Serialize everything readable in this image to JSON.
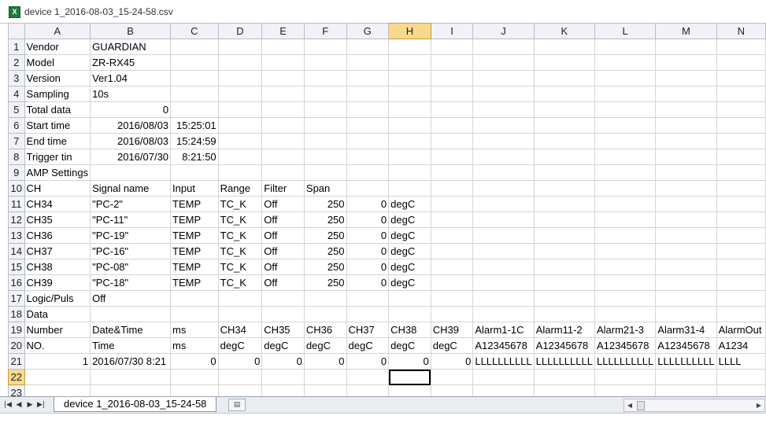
{
  "window": {
    "title": "device 1_2016-08-03_15-24-58.csv",
    "icon": "excel-icon"
  },
  "columns": [
    "A",
    "B",
    "C",
    "D",
    "E",
    "F",
    "G",
    "H",
    "I",
    "J",
    "K",
    "L",
    "M",
    "N"
  ],
  "selected_column": "H",
  "selected_row": 22,
  "rows": [
    {
      "n": "1",
      "cells": [
        "Vendor",
        "GUARDIAN",
        "",
        "",
        "",
        "",
        "",
        "",
        "",
        "",
        "",
        "",
        "",
        ""
      ]
    },
    {
      "n": "2",
      "cells": [
        "Model",
        "ZR-RX45",
        "",
        "",
        "",
        "",
        "",
        "",
        "",
        "",
        "",
        "",
        "",
        ""
      ]
    },
    {
      "n": "3",
      "cells": [
        "Version",
        "Ver1.04",
        "",
        "",
        "",
        "",
        "",
        "",
        "",
        "",
        "",
        "",
        "",
        ""
      ]
    },
    {
      "n": "4",
      "cells": [
        "Sampling",
        "10s",
        "",
        "",
        "",
        "",
        "",
        "",
        "",
        "",
        "",
        "",
        "",
        ""
      ]
    },
    {
      "n": "5",
      "cells": [
        "Total data",
        "0",
        "",
        "",
        "",
        "",
        "",
        "",
        "",
        "",
        "",
        "",
        "",
        ""
      ]
    },
    {
      "n": "6",
      "cells": [
        "Start time",
        "2016/08/03",
        "15:25:01",
        "",
        "",
        "",
        "",
        "",
        "",
        "",
        "",
        "",
        "",
        ""
      ]
    },
    {
      "n": "7",
      "cells": [
        "End time",
        "2016/08/03",
        "15:24:59",
        "",
        "",
        "",
        "",
        "",
        "",
        "",
        "",
        "",
        "",
        ""
      ]
    },
    {
      "n": "8",
      "cells": [
        "Trigger tin",
        "2016/07/30",
        "8:21:50",
        "",
        "",
        "",
        "",
        "",
        "",
        "",
        "",
        "",
        "",
        ""
      ]
    },
    {
      "n": "9",
      "cells": [
        "AMP Settings",
        "",
        "",
        "",
        "",
        "",
        "",
        "",
        "",
        "",
        "",
        "",
        "",
        ""
      ]
    },
    {
      "n": "10",
      "cells": [
        "CH",
        "Signal name",
        "Input",
        "Range",
        "Filter",
        "Span",
        "",
        "",
        "",
        "",
        "",
        "",
        "",
        ""
      ]
    },
    {
      "n": "11",
      "cells": [
        "CH34",
        "\"PC-2\"",
        "TEMP",
        "TC_K",
        "Off",
        "250",
        "0",
        "degC",
        "",
        "",
        "",
        "",
        "",
        ""
      ]
    },
    {
      "n": "12",
      "cells": [
        "CH35",
        "\"PC-11\"",
        "TEMP",
        "TC_K",
        "Off",
        "250",
        "0",
        "degC",
        "",
        "",
        "",
        "",
        "",
        ""
      ]
    },
    {
      "n": "13",
      "cells": [
        "CH36",
        "\"PC-19\"",
        "TEMP",
        "TC_K",
        "Off",
        "250",
        "0",
        "degC",
        "",
        "",
        "",
        "",
        "",
        ""
      ]
    },
    {
      "n": "14",
      "cells": [
        "CH37",
        "\"PC-16\"",
        "TEMP",
        "TC_K",
        "Off",
        "250",
        "0",
        "degC",
        "",
        "",
        "",
        "",
        "",
        ""
      ]
    },
    {
      "n": "15",
      "cells": [
        "CH38",
        "\"PC-08\"",
        "TEMP",
        "TC_K",
        "Off",
        "250",
        "0",
        "degC",
        "",
        "",
        "",
        "",
        "",
        ""
      ]
    },
    {
      "n": "16",
      "cells": [
        "CH39",
        "\"PC-18\"",
        "TEMP",
        "TC_K",
        "Off",
        "250",
        "0",
        "degC",
        "",
        "",
        "",
        "",
        "",
        ""
      ]
    },
    {
      "n": "17",
      "cells": [
        "Logic/Puls",
        "Off",
        "",
        "",
        "",
        "",
        "",
        "",
        "",
        "",
        "",
        "",
        "",
        ""
      ]
    },
    {
      "n": "18",
      "cells": [
        "Data",
        "",
        "",
        "",
        "",
        "",
        "",
        "",
        "",
        "",
        "",
        "",
        "",
        ""
      ]
    },
    {
      "n": "19",
      "cells": [
        "Number",
        "Date&Time",
        "ms",
        "CH34",
        "CH35",
        "CH36",
        "CH37",
        "CH38",
        "CH39",
        "Alarm1-1C",
        "Alarm11-2",
        "Alarm21-3",
        "Alarm31-4",
        "AlarmOut"
      ]
    },
    {
      "n": "20",
      "cells": [
        "NO.",
        "Time",
        "ms",
        "degC",
        "degC",
        "degC",
        "degC",
        "degC",
        "degC",
        "A12345678",
        "A12345678",
        "A12345678",
        "A12345678",
        "A1234"
      ]
    },
    {
      "n": "21",
      "cells": [
        "1",
        "2016/07/30 8:21",
        "0",
        "0",
        "0",
        "0",
        "0",
        "0",
        "0",
        "LLLLLLLLLL",
        "LLLLLLLLLL",
        "LLLLLLLLLL",
        "LLLLLLLLLL",
        "LLLL"
      ]
    },
    {
      "n": "22",
      "cells": [
        "",
        "",
        "",
        "",
        "",
        "",
        "",
        "",
        "",
        "",
        "",
        "",
        "",
        ""
      ]
    },
    {
      "n": "23",
      "cells": [
        "",
        "",
        "",
        "",
        "",
        "",
        "",
        "",
        "",
        "",
        "",
        "",
        "",
        ""
      ]
    }
  ],
  "sheet_tab": {
    "label": "device 1_2016-08-03_15-24-58"
  }
}
